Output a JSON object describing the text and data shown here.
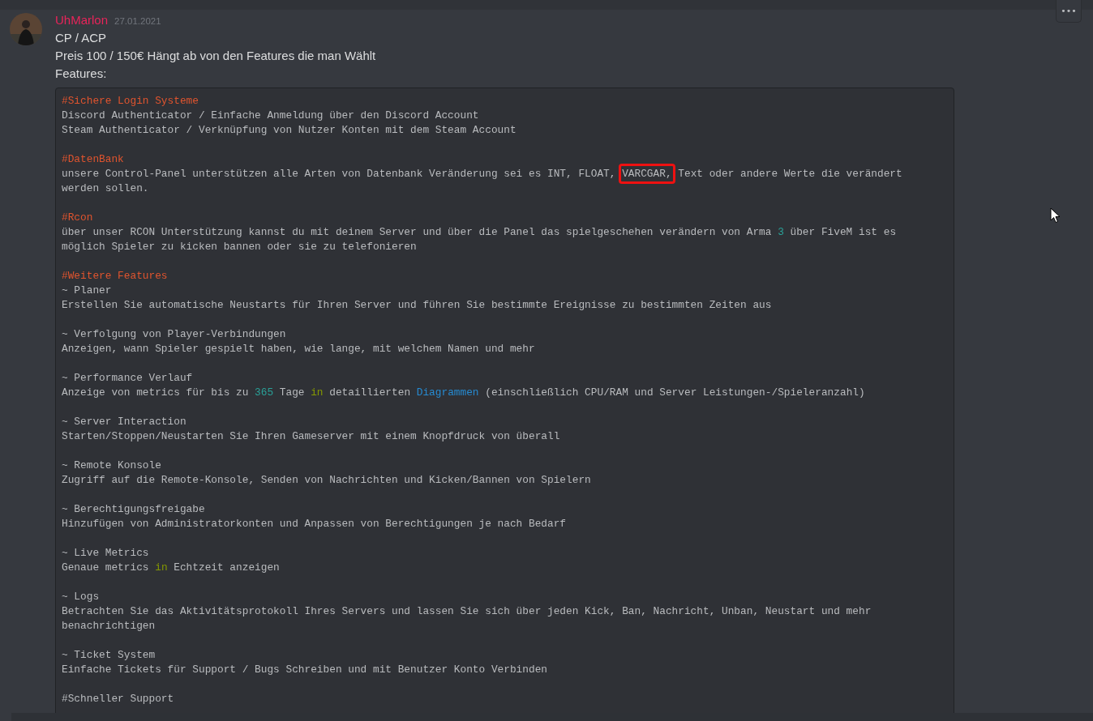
{
  "message": {
    "author": "UhMarlon",
    "timestamp": "27.01.2021",
    "lines": [
      "CP / ACP",
      "Preis 100 / 150€ Hängt ab von den Features die man Wählt",
      "Features:"
    ],
    "more_button": "•••",
    "code_blocks": [
      [
        [
          {
            "text": "#Sichere Login Systeme",
            "kind": "heading"
          }
        ],
        [
          {
            "text": "Discord Authenticator / Einfache Anmeldung über den Discord Account",
            "kind": "plain"
          }
        ],
        [
          {
            "text": "Steam Authenticator / Verknüpfung von Nutzer Konten mit dem Steam Account",
            "kind": "plain"
          }
        ]
      ],
      [
        [
          {
            "text": "#DatenBank",
            "kind": "heading"
          }
        ],
        [
          {
            "text": "unsere Control-Panel unterstützen alle Arten von Datenbank Veränderung sei es INT, FLOAT, ",
            "kind": "plain"
          },
          {
            "text": "VARCGAR,",
            "kind": "plain",
            "circled": true
          },
          {
            "text": " Text oder andere Werte die verändert",
            "kind": "plain"
          }
        ],
        [
          {
            "text": "werden sollen.",
            "kind": "plain"
          }
        ]
      ],
      [
        [
          {
            "text": "#Rcon",
            "kind": "heading"
          }
        ],
        [
          {
            "text": "über unser RCON Unterstützung kannst du mit deinem Server und über die Panel das spielgeschehen verändern von Arma ",
            "kind": "plain"
          },
          {
            "text": "3",
            "kind": "number"
          },
          {
            "text": " über FiveM ist es",
            "kind": "plain"
          }
        ],
        [
          {
            "text": "möglich Spieler zu kicken bannen oder sie zu telefonieren",
            "kind": "plain"
          }
        ]
      ],
      [
        [
          {
            "text": "#Weitere Features",
            "kind": "heading"
          }
        ],
        [
          {
            "text": "~ Planer",
            "kind": "plain"
          }
        ],
        [
          {
            "text": "Erstellen Sie automatische Neustarts für Ihren Server und führen Sie bestimmte Ereignisse zu bestimmten Zeiten aus",
            "kind": "plain"
          }
        ]
      ],
      [
        [
          {
            "text": "~ Verfolgung von Player-Verbindungen",
            "kind": "plain"
          }
        ],
        [
          {
            "text": "Anzeigen, wann Spieler gespielt haben, wie lange, mit welchem Namen und mehr",
            "kind": "plain"
          }
        ]
      ],
      [
        [
          {
            "text": "~ Performance Verlauf",
            "kind": "plain"
          }
        ],
        [
          {
            "text": "Anzeige von metrics für bis zu ",
            "kind": "plain"
          },
          {
            "text": "365",
            "kind": "number"
          },
          {
            "text": " Tage ",
            "kind": "plain"
          },
          {
            "text": "in",
            "kind": "keyword"
          },
          {
            "text": " detaillierten ",
            "kind": "plain"
          },
          {
            "text": "Diagrammen",
            "kind": "builtin"
          },
          {
            "text": " (einschließlich CPU/RAM und Server Leistungen-/Spieleranzahl)",
            "kind": "plain"
          }
        ]
      ],
      [
        [
          {
            "text": "~ Server Interaction",
            "kind": "plain"
          }
        ],
        [
          {
            "text": "Starten/Stoppen/Neustarten Sie Ihren Gameserver mit einem Knopfdruck von überall",
            "kind": "plain"
          }
        ]
      ],
      [
        [
          {
            "text": "~ Remote Konsole",
            "kind": "plain"
          }
        ],
        [
          {
            "text": "Zugriff auf die Remote-Konsole, Senden von Nachrichten und Kicken/Bannen von Spielern",
            "kind": "plain"
          }
        ]
      ],
      [
        [
          {
            "text": "~ Berechtigungsfreigabe",
            "kind": "plain"
          }
        ],
        [
          {
            "text": "Hinzufügen von Administratorkonten und Anpassen von Berechtigungen je nach Bedarf",
            "kind": "plain"
          }
        ]
      ],
      [
        [
          {
            "text": "~ Live Metrics",
            "kind": "plain"
          }
        ],
        [
          {
            "text": "Genaue metrics ",
            "kind": "plain"
          },
          {
            "text": "in",
            "kind": "keyword"
          },
          {
            "text": " Echtzeit anzeigen",
            "kind": "plain"
          }
        ]
      ],
      [
        [
          {
            "text": "~ Logs",
            "kind": "plain"
          }
        ],
        [
          {
            "text": "Betrachten Sie das Aktivitätsprotokoll Ihres Servers und lassen Sie sich über jeden Kick, Ban, Nachricht, Unban, Neustart und mehr",
            "kind": "plain"
          }
        ],
        [
          {
            "text": "benachrichtigen",
            "kind": "plain"
          }
        ]
      ],
      [
        [
          {
            "text": "~ Ticket System",
            "kind": "plain"
          }
        ],
        [
          {
            "text": "Einfache Tickets für Support / Bugs Schreiben und mit Benutzer Konto Verbinden",
            "kind": "plain"
          }
        ]
      ],
      [
        [
          {
            "text": "#Schneller Support",
            "kind": "plain"
          }
        ]
      ]
    ]
  }
}
